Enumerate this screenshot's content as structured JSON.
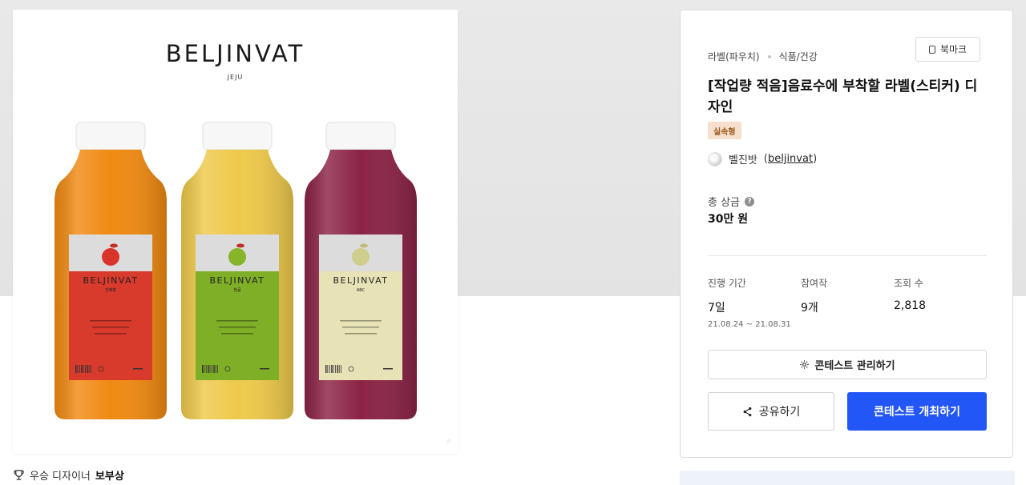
{
  "image": {
    "brand": "BELJINVAT",
    "brand_sub": "JEJU",
    "bottles": [
      {
        "label_brand": "BELJINVAT",
        "label_sub": "천혜향",
        "color": "#f08a12",
        "label_color": "#d83a2c",
        "fruit_color": "#d8342a"
      },
      {
        "label_brand": "BELJINVAT",
        "label_sub": "청귤",
        "color": "#eec94a",
        "label_color": "#7fae27",
        "fruit_color": "#86b52a"
      },
      {
        "label_brand": "BELJINVAT",
        "label_sub": "ABC",
        "color": "#8b2346",
        "label_color": "#e8e3b6",
        "fruit_color": "#cfce8c"
      }
    ]
  },
  "award": {
    "prefix": "우승 디자이너",
    "name": "보부상"
  },
  "info": {
    "category": "라벨(파우치)",
    "subcategory": "식품/건강",
    "bookmark_label": "북마크",
    "title": "[작업량 적음]음료수에 부착할 라벨(스티커) 디자인",
    "badge": "실속형",
    "host_name": "벨진밧",
    "host_id": "beljinvat",
    "prize_label": "총 상금",
    "prize_value": "30만 원",
    "stats": {
      "period_label": "진행 기간",
      "period_value": "7일",
      "period_range": "21.08.24 ~ 21.08.31",
      "entries_label": "참여작",
      "entries_value": "9개",
      "views_label": "조회 수",
      "views_value": "2,818"
    },
    "manage_label": "콘테스트 관리하기",
    "share_label": "공유하기",
    "host_contest_label": "콘테스트 개최하기"
  },
  "colors": {
    "primary": "#2356f6",
    "badge_bg": "#f6dfcc",
    "badge_text": "#9a5a20"
  },
  "icons": [
    "trophy-icon",
    "bookmark-icon",
    "help-icon",
    "gear-icon",
    "share-icon",
    "avatar-icon"
  ]
}
